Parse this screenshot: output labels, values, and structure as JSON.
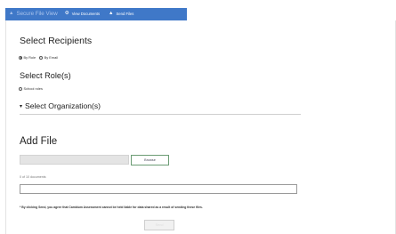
{
  "nav": {
    "brand": "Secure File View",
    "items": [
      {
        "label": "View Documents",
        "icon": "gear-icon"
      },
      {
        "label": "Send Files",
        "icon": "user-icon"
      }
    ]
  },
  "recipients": {
    "heading": "Select Recipients",
    "options": [
      {
        "label": "By Role",
        "checked": true
      },
      {
        "label": "By Email",
        "checked": false
      }
    ]
  },
  "roles": {
    "heading": "Select Role(s)",
    "option": "School roles"
  },
  "organization": {
    "heading": "Select Organization(s)"
  },
  "add_file": {
    "heading": "Add File",
    "browse_label": "Browse",
    "count_text": "0 of 10 documents",
    "disclaimer": "* By clicking Send, you agree that Cambium Assessment cannot be held liable for data shared as a result of sending these files.",
    "send_label": "Send"
  },
  "colors": {
    "nav_bg": "#3f78c8",
    "browse_border": "#6b9c74"
  }
}
